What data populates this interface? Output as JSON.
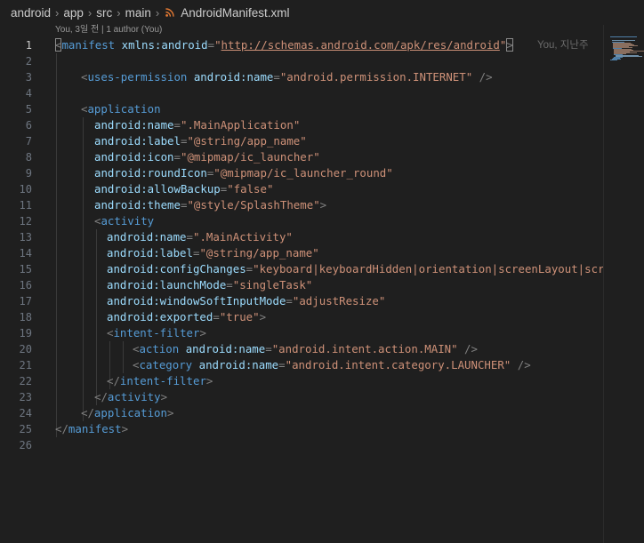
{
  "breadcrumb": {
    "items": [
      "android",
      "app",
      "src",
      "main"
    ],
    "file": "AndroidManifest.xml",
    "file_icon": "rss-xml-icon",
    "separator_icon": "chevron-right-icon"
  },
  "editor": {
    "codelens": "You, 3일 전 | 1 author (You)",
    "blame_inline": "You, 지난주",
    "active_line": 1,
    "line_numbers": [
      "1",
      "2",
      "3",
      "4",
      "5",
      "6",
      "7",
      "8",
      "9",
      "10",
      "11",
      "12",
      "13",
      "14",
      "15",
      "16",
      "17",
      "18",
      "19",
      "20",
      "21",
      "22",
      "23",
      "24",
      "25",
      "26"
    ]
  },
  "code": {
    "l1_tag": "manifest",
    "l1_attr": "xmlns:android",
    "l1_url": "http://schemas.android.com/apk/res/android",
    "l3_tag": "uses-permission",
    "l3_attr": "android:name",
    "l3_val": "\"android.permission.INTERNET\"",
    "l5_tag": "application",
    "l6_attr": "android:name",
    "l6_val": "\".MainApplication\"",
    "l7_attr": "android:label",
    "l7_val": "\"@string/app_name\"",
    "l8_attr": "android:icon",
    "l8_val": "\"@mipmap/ic_launcher\"",
    "l9_attr": "android:roundIcon",
    "l9_val": "\"@mipmap/ic_launcher_round\"",
    "l10_attr": "android:allowBackup",
    "l10_val": "\"false\"",
    "l11_attr": "android:theme",
    "l11_val": "\"@style/SplashTheme\"",
    "l12_tag": "activity",
    "l13_attr": "android:name",
    "l13_val": "\".MainActivity\"",
    "l14_attr": "android:label",
    "l14_val": "\"@string/app_name\"",
    "l15_attr": "android:configChanges",
    "l15_val": "\"keyboard|keyboardHidden|orientation|screenLayout|screenSize|smallestScreenSize|uiMode\"",
    "l16_attr": "android:launchMode",
    "l16_val": "\"singleTask\"",
    "l17_attr": "android:windowSoftInputMode",
    "l17_val": "\"adjustResize\"",
    "l18_attr": "android:exported",
    "l18_val": "\"true\"",
    "l19_tag": "intent-filter",
    "l20_tag": "action",
    "l20_attr": "android:name",
    "l20_val": "\"android.intent.action.MAIN\"",
    "l21_tag": "category",
    "l21_attr": "android:name",
    "l21_val": "\"android.intent.category.LAUNCHER\"",
    "l22_tag": "intent-filter",
    "l23_tag": "activity",
    "l24_tag": "application",
    "l25_tag": "manifest"
  },
  "colors": {
    "background": "#1f1f1f",
    "tag": "#569cd6",
    "attribute": "#9cdcfe",
    "string": "#ce9178",
    "punctuation": "#808080",
    "line_number": "#6e7681",
    "rss_icon": "#e37933"
  }
}
